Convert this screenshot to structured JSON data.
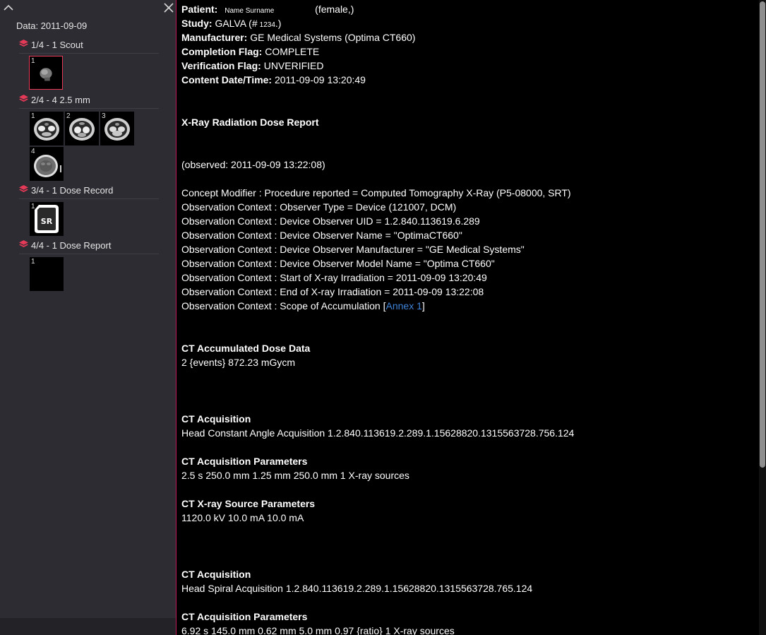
{
  "sidebar": {
    "date_label": "Data: 2011-09-09",
    "series": [
      {
        "label": "1/4 - 1 Scout",
        "thumbnails": [
          {
            "number": "1",
            "kind": "scout",
            "selected": true
          }
        ]
      },
      {
        "label": "2/4 - 4 2.5 mm",
        "thumbnails": [
          {
            "number": "1",
            "kind": "ct-slice"
          },
          {
            "number": "2",
            "kind": "ct-slice"
          },
          {
            "number": "3",
            "kind": "ct-slice"
          },
          {
            "number": "4",
            "kind": "ct-head"
          }
        ]
      },
      {
        "label": "3/4 - 1 Dose Record",
        "thumbnails": [
          {
            "number": "1",
            "kind": "sr-document",
            "icon_text": "SR"
          }
        ]
      },
      {
        "label": "4/4 - 1 Dose Report",
        "thumbnails": [
          {
            "number": "1",
            "kind": "blank"
          }
        ]
      }
    ],
    "icons": {
      "collapse": "chevron-up-icon",
      "close": "close-icon",
      "series": "layers-icon"
    },
    "colors": {
      "accent": "#e53958",
      "panel": "#2c2c32"
    }
  },
  "header": {
    "patient": {
      "label": "Patient:",
      "name": "Name Surname",
      "sex": "(female,)"
    },
    "study": {
      "label": "Study:",
      "prefix": "GALVA (#",
      "id": "1234",
      "suffix": ".)"
    },
    "manufacturer": {
      "label": "Manufacturer:",
      "value": "GE Medical Systems (Optima CT660)"
    },
    "completion": {
      "label": "Completion Flag:",
      "value": "COMPLETE"
    },
    "verification": {
      "label": "Verification Flag:",
      "value": "UNVERIFIED"
    },
    "content_datetime": {
      "label": "Content Date/Time:",
      "value": "2011-09-09 13:20:49"
    }
  },
  "report": {
    "title": "X-Ray Radiation Dose Report",
    "observed": "(observed: 2011-09-09 13:22:08)",
    "context_lines": [
      "Concept Modifier : Procedure reported = Computed Tomography X-Ray (P5-08000, SRT)",
      "Observation Context : Observer Type = Device (121007, DCM)",
      "Observation Context : Device Observer UID = 1.2.840.113619.6.289",
      "Observation Context : Device Observer Name = \"OptimaCT660\"",
      "Observation Context : Device Observer Manufacturer = \"GE Medical Systems\"",
      "Observation Context : Device Observer Model Name = \"Optima CT660\"",
      "Observation Context : Start of X-ray Irradiation = 2011-09-09 13:20:49",
      "Observation Context : End of X-ray Irradiation = 2011-09-09 13:22:08"
    ],
    "scope_line": {
      "prefix": "Observation Context : Scope of Accumulation [",
      "link": "Annex 1",
      "suffix": "]"
    },
    "accumulated": {
      "heading": "CT Accumulated Dose Data",
      "value": "2 {events} 872.23 mGycm"
    },
    "acquisitions": [
      {
        "heading": "CT Acquisition",
        "value": "Head Constant Angle Acquisition 1.2.840.113619.2.289.1.15628820.1315563728.756.124",
        "params_heading": "CT Acquisition Parameters",
        "params_value": "2.5 s 250.0 mm 1.25 mm 250.0 mm 1 X-ray sources",
        "source_heading": "CT X-ray Source Parameters",
        "source_value": "1120.0 kV 10.0 mA 10.0 mA"
      },
      {
        "heading": "CT Acquisition",
        "value": "Head Spiral Acquisition 1.2.840.113619.2.289.1.15628820.1315563728.765.124",
        "params_heading": "CT Acquisition Parameters",
        "params_value": "6.92 s 145.0 mm 0.62 mm 5.0 mm 0.97 {ratio} 1 X-ray sources"
      }
    ]
  }
}
